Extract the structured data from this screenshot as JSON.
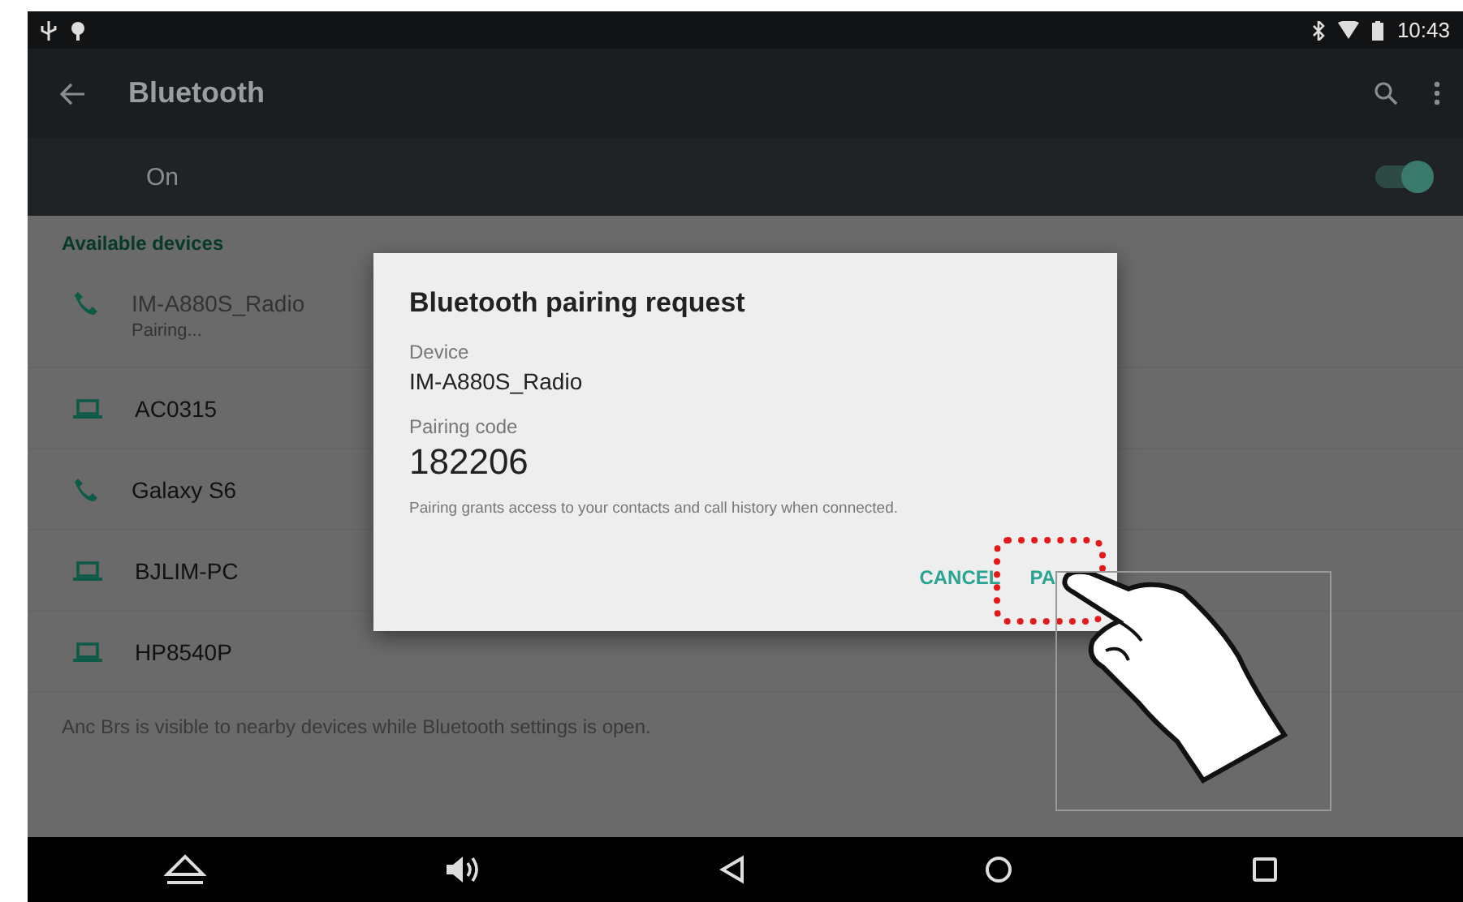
{
  "status_bar": {
    "time": "10:43"
  },
  "app_bar": {
    "title": "Bluetooth"
  },
  "master_switch": {
    "label": "On",
    "on": true
  },
  "section_header": "Available devices",
  "devices": [
    {
      "kind": "phone",
      "name": "IM-A880S_Radio",
      "subtitle": "Pairing...",
      "disabled": true
    },
    {
      "kind": "laptop",
      "name": "AC0315",
      "disabled": false
    },
    {
      "kind": "phone",
      "name": "Galaxy S6",
      "disabled": false
    },
    {
      "kind": "laptop",
      "name": "BJLIM-PC",
      "disabled": false
    },
    {
      "kind": "laptop",
      "name": "HP8540P",
      "disabled": false
    }
  ],
  "footer_note": "Anc Brs is visible to nearby devices while Bluetooth settings is open.",
  "dialog": {
    "title": "Bluetooth pairing request",
    "device_label": "Device",
    "device_name": "IM-A880S_Radio",
    "code_label": "Pairing code",
    "code": "182206",
    "note": "Pairing grants access to your contacts and call history when connected.",
    "buttons": [
      "CANCEL",
      "PA"
    ]
  }
}
